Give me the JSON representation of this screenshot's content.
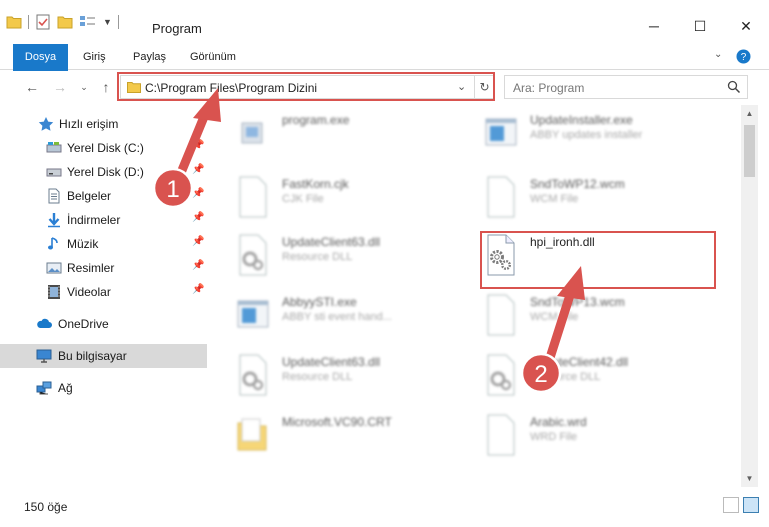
{
  "window": {
    "title": "Program",
    "minimize": "─",
    "maximize": "☐",
    "close": "✕"
  },
  "ribbon": {
    "tabs": [
      "Dosya",
      "Giriş",
      "Paylaş",
      "Görünüm"
    ]
  },
  "address": {
    "path": "C:\\Program Files\\Program Dizini"
  },
  "search": {
    "placeholder": "Ara: Program"
  },
  "sidebar": {
    "items": [
      {
        "label": "Hızlı erişim",
        "icon": "star-icon"
      },
      {
        "label": "Yerel Disk (C:)",
        "icon": "drive-icon",
        "pinned": true
      },
      {
        "label": "Yerel Disk (D:)",
        "icon": "drive-icon",
        "pinned": true
      },
      {
        "label": "Belgeler",
        "icon": "documents-icon",
        "pinned": true
      },
      {
        "label": "İndirmeler",
        "icon": "download-icon",
        "pinned": true
      },
      {
        "label": "Müzik",
        "icon": "music-icon",
        "pinned": true
      },
      {
        "label": "Resimler",
        "icon": "pictures-icon",
        "pinned": true
      },
      {
        "label": "Videolar",
        "icon": "videos-icon",
        "pinned": true
      },
      {
        "label": "OneDrive",
        "icon": "cloud-icon"
      },
      {
        "label": "Bu bilgisayar",
        "icon": "computer-icon",
        "selected": true
      },
      {
        "label": "Ağ",
        "icon": "network-icon"
      }
    ]
  },
  "files": [
    {
      "name": "program.exe",
      "type": "",
      "icon": "exe-icon"
    },
    {
      "name": "UpdateInstaller.exe",
      "type": "ABBY updates installer",
      "icon": "app-window-icon"
    },
    {
      "name": "FastKorn.cjk",
      "type": "CJK File",
      "icon": "blank-file-icon"
    },
    {
      "name": "SndToWP12.wcm",
      "type": "WCM File",
      "icon": "blank-file-icon"
    },
    {
      "name": "UpdateClient63.dll",
      "type": "Resource DLL",
      "icon": "dll-gear-icon"
    },
    {
      "name": "hpi_ironh.dll",
      "type": "",
      "icon": "dll-gear-icon"
    },
    {
      "name": "AbbyySTI.exe",
      "type": "ABBY sti event hand...",
      "icon": "app-window-icon"
    },
    {
      "name": "SndToWP13.wcm",
      "type": "WCM File",
      "icon": "blank-file-icon"
    },
    {
      "name": "UpdateClient63.dll",
      "type": "Resource DLL",
      "icon": "dll-gear-icon"
    },
    {
      "name": "UpdateClient42.dll",
      "type": "Resource DLL",
      "icon": "dll-gear-icon"
    },
    {
      "name": "Microsoft.VC90.CRT",
      "type": "",
      "icon": "folder-icon"
    },
    {
      "name": "Arabic.wrd",
      "type": "WRD File",
      "icon": "blank-file-icon"
    }
  ],
  "status": {
    "count": "150 öğe"
  },
  "annotations": {
    "step1": "1",
    "step2": "2",
    "color": "#d9534f"
  }
}
